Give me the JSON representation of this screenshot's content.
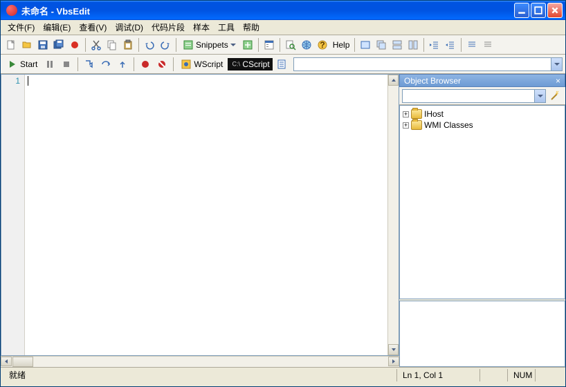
{
  "title": "未命名 - VbsEdit",
  "menu": [
    "文件(F)",
    "编辑(E)",
    "查看(V)",
    "调试(D)",
    "代码片段",
    "样本",
    "工具",
    "帮助"
  ],
  "toolbar1": {
    "snippets_label": "Snippets",
    "help_label": "Help"
  },
  "toolbar2": {
    "start_label": "Start",
    "wscript_label": "WScript",
    "cscript_label": "CScript"
  },
  "editor": {
    "line_number": "1"
  },
  "object_browser": {
    "title": "Object Browser",
    "nodes": [
      {
        "label": "IHost"
      },
      {
        "label": "WMI Classes"
      }
    ]
  },
  "statusbar": {
    "ready": "就绪",
    "position": "Ln 1, Col 1",
    "num": "NUM"
  }
}
